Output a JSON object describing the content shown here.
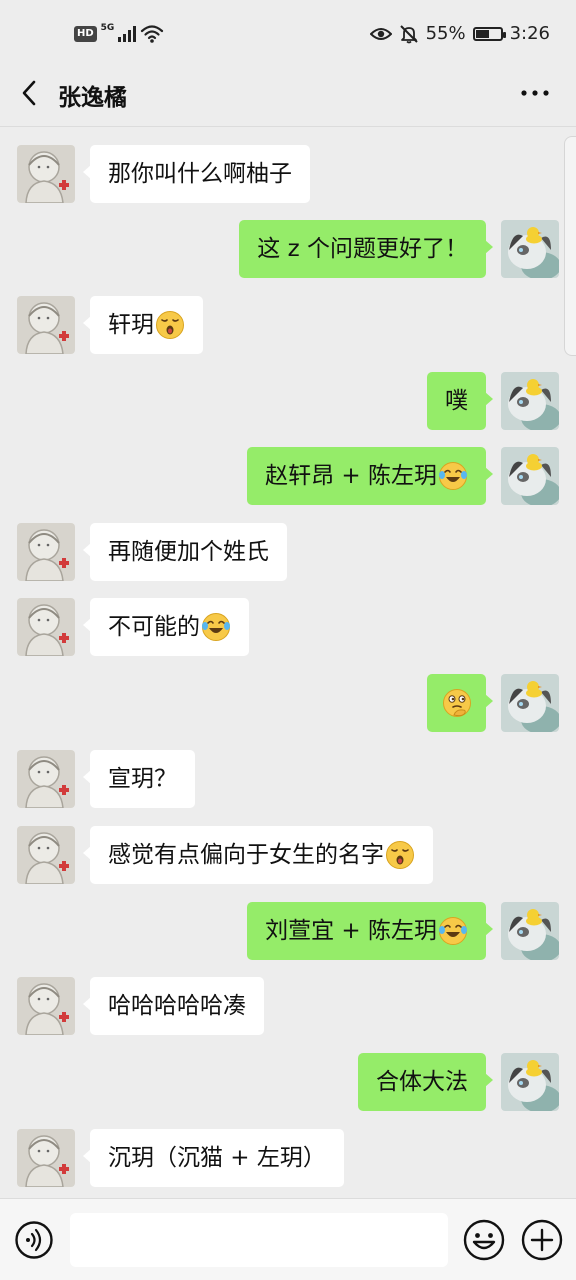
{
  "status_bar": {
    "hd": "HD",
    "network": "5G",
    "battery_percent": "55%",
    "battery_level": 0.55,
    "time": "3:26",
    "icons": [
      "eye-icon",
      "bell-off-icon",
      "wifi-icon",
      "signal-icon"
    ]
  },
  "header": {
    "title": "张逸橘",
    "back_icon": "chevron-left-icon",
    "more_icon": "more-dots-icon"
  },
  "messages": [
    {
      "side": "left",
      "text": "那你叫什么啊柚子",
      "emoji": ""
    },
    {
      "side": "right",
      "text": "这 z 个问题更好了！",
      "emoji": ""
    },
    {
      "side": "left",
      "text": "轩玥",
      "emoji": "surprised-face-emoji"
    },
    {
      "side": "right",
      "text": "噗",
      "emoji": ""
    },
    {
      "side": "right",
      "text": "赵轩昂 + 陈左玥",
      "emoji": "tears-of-joy-emoji"
    },
    {
      "side": "left",
      "text": "再随便加个姓氏",
      "emoji": ""
    },
    {
      "side": "left",
      "text": "不可能的",
      "emoji": "tears-of-joy-emoji"
    },
    {
      "side": "right",
      "text": "",
      "emoji": "thinking-face-emoji"
    },
    {
      "side": "left",
      "text": "宣玥？",
      "emoji": ""
    },
    {
      "side": "left",
      "text": "感觉有点偏向于女生的名字",
      "emoji": "surprised-face-emoji"
    },
    {
      "side": "right",
      "text": "刘萱宜 + 陈左玥",
      "emoji": "tears-of-joy-emoji"
    },
    {
      "side": "left",
      "text": "哈哈哈哈哈凑",
      "emoji": ""
    },
    {
      "side": "right",
      "text": "合体大法",
      "emoji": ""
    },
    {
      "side": "left",
      "text": "沉玥（沉猫 + 左玥）",
      "emoji": ""
    }
  ],
  "composer": {
    "input_value": "",
    "voice_icon": "voice-icon",
    "emoji_icon": "emoji-icon",
    "plus_icon": "plus-circle-icon"
  },
  "colors": {
    "background": "#ededed",
    "bubble_sent": "#95ec69",
    "bubble_received": "#ffffff",
    "text": "#111111"
  }
}
